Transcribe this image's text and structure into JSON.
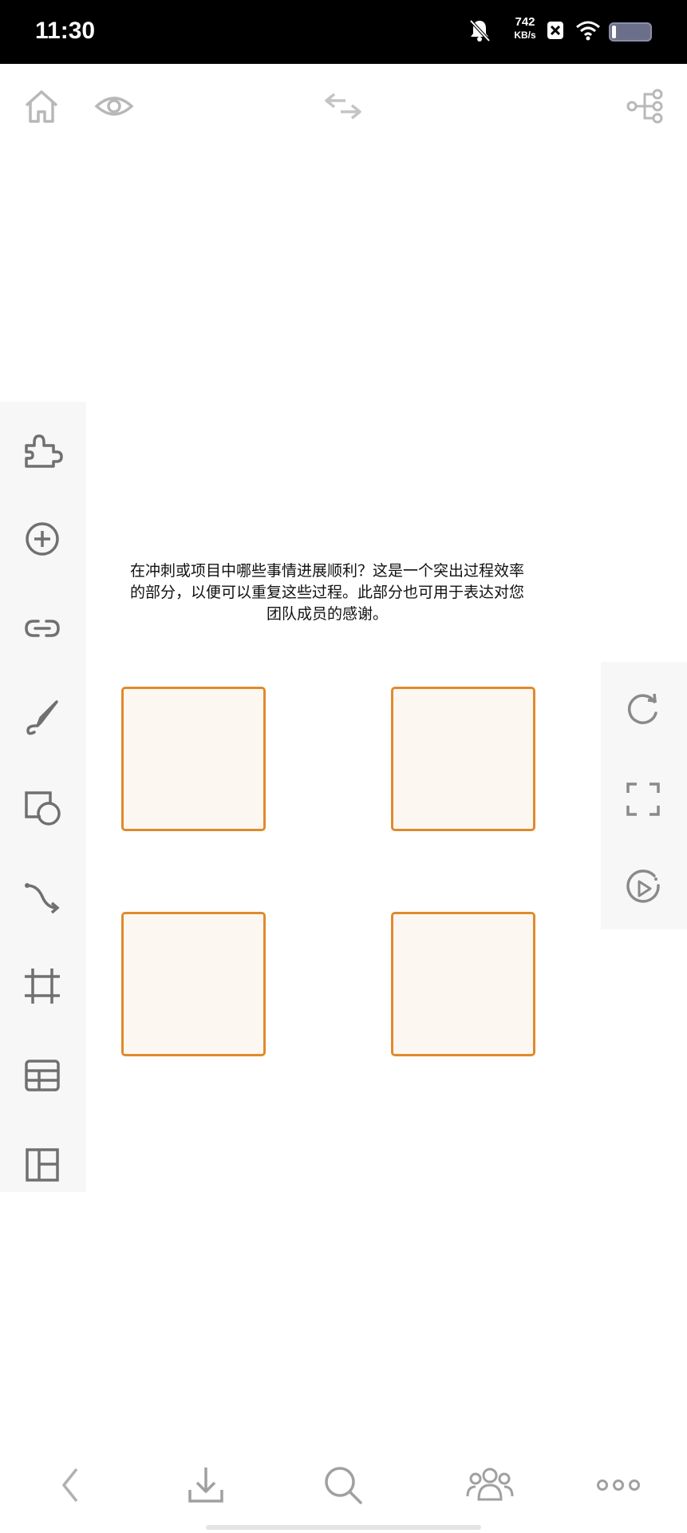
{
  "status_bar": {
    "time": "11:30",
    "net_speed_value": "742",
    "net_speed_unit": "KB/s",
    "icons": [
      "mute-bell-icon",
      "app-notification-icon",
      "wifi-icon",
      "battery-icon"
    ]
  },
  "top_bar": {
    "icons": [
      "home-icon",
      "preview-eye-icon",
      "swap-arrows-icon",
      "mind-map-structure-icon"
    ]
  },
  "left_toolbar": {
    "icons": [
      "plugin-puzzle-icon",
      "add-circle-icon",
      "link-icon",
      "pen-draw-icon",
      "shape-icon",
      "connector-curve-icon",
      "frame-icon",
      "table-icon",
      "layout-icon"
    ]
  },
  "right_toolbar": {
    "icons": [
      "refresh-icon",
      "fullscreen-icon",
      "presentation-play-icon"
    ]
  },
  "canvas": {
    "prompt_text": "在冲刺或项目中哪些事情进展顺利？这是一个突出过程效率的部分，以便可以重复这些过程。此部分也可用于表达对您团队成员的感谢。",
    "sticky_notes_count": 4,
    "sticky_border_color": "#e08a2c",
    "sticky_fill_color": "#fdf7f1"
  },
  "bottom_bar": {
    "icons": [
      "back-chevron-icon",
      "download-icon",
      "search-icon",
      "collaborators-icon",
      "more-dots-icon"
    ]
  }
}
